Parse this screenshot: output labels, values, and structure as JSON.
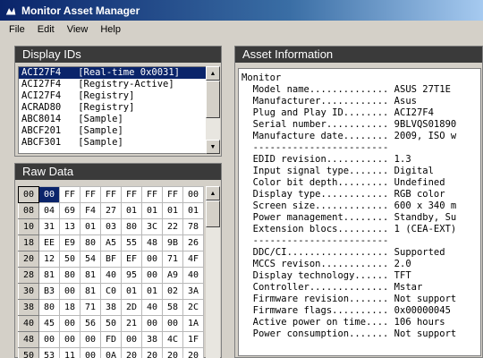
{
  "window": {
    "title": "Monitor Asset Manager"
  },
  "menu": [
    "File",
    "Edit",
    "View",
    "Help"
  ],
  "display_ids": {
    "title": "Display IDs",
    "items": [
      "ACI27F4   [Real-time 0x0031]",
      "ACI27F4   [Registry-Active]",
      "ACI27F4   [Registry]",
      "ACRAD80   [Registry]",
      "ABC8014   [Sample]",
      "ABCF201   [Sample]",
      "ABCF301   [Sample]"
    ],
    "selected_index": 0
  },
  "raw_data": {
    "title": "Raw Data",
    "rows": [
      {
        "offset": "00",
        "bytes": [
          "00",
          "FF",
          "FF",
          "FF",
          "FF",
          "FF",
          "FF",
          "00"
        ]
      },
      {
        "offset": "08",
        "bytes": [
          "04",
          "69",
          "F4",
          "27",
          "01",
          "01",
          "01",
          "01"
        ]
      },
      {
        "offset": "10",
        "bytes": [
          "31",
          "13",
          "01",
          "03",
          "80",
          "3C",
          "22",
          "78"
        ]
      },
      {
        "offset": "18",
        "bytes": [
          "EE",
          "E9",
          "80",
          "A5",
          "55",
          "48",
          "9B",
          "26"
        ]
      },
      {
        "offset": "20",
        "bytes": [
          "12",
          "50",
          "54",
          "BF",
          "EF",
          "00",
          "71",
          "4F"
        ]
      },
      {
        "offset": "28",
        "bytes": [
          "81",
          "80",
          "81",
          "40",
          "95",
          "00",
          "A9",
          "40"
        ]
      },
      {
        "offset": "30",
        "bytes": [
          "B3",
          "00",
          "81",
          "C0",
          "01",
          "01",
          "02",
          "3A"
        ]
      },
      {
        "offset": "38",
        "bytes": [
          "80",
          "18",
          "71",
          "38",
          "2D",
          "40",
          "58",
          "2C"
        ]
      },
      {
        "offset": "40",
        "bytes": [
          "45",
          "00",
          "56",
          "50",
          "21",
          "00",
          "00",
          "1A"
        ]
      },
      {
        "offset": "48",
        "bytes": [
          "00",
          "00",
          "00",
          "FD",
          "00",
          "38",
          "4C",
          "1F"
        ]
      },
      {
        "offset": "50",
        "bytes": [
          "53",
          "11",
          "00",
          "0A",
          "20",
          "20",
          "20",
          "20"
        ]
      }
    ]
  },
  "asset_info": {
    "title": "Asset Information",
    "lines": [
      "Monitor",
      "  Model name.............. ASUS 27T1E",
      "  Manufacturer............ Asus",
      "  Plug and Play ID........ ACI27F4",
      "  Serial number........... 9BLVQS01890",
      "  Manufacture date........ 2009, ISO w",
      "  ------------------------",
      "  EDID revision........... 1.3",
      "  Input signal type....... Digital",
      "  Color bit depth......... Undefined",
      "  Display type............ RGB color",
      "  Screen size............. 600 x 340 m",
      "  Power management........ Standby, Su",
      "  Extension blocs......... 1 (CEA-EXT)",
      "  ------------------------",
      "  DDC/CI.................. Supported",
      "  MCCS revison............ 2.0",
      "  Display technology...... TFT",
      "  Controller.............. Mstar",
      "  Firmware revision....... Not support",
      "  Firmware flags.......... 0x00000045",
      "  Active power on time.... 106 hours",
      "  Power consumption....... Not support"
    ]
  }
}
